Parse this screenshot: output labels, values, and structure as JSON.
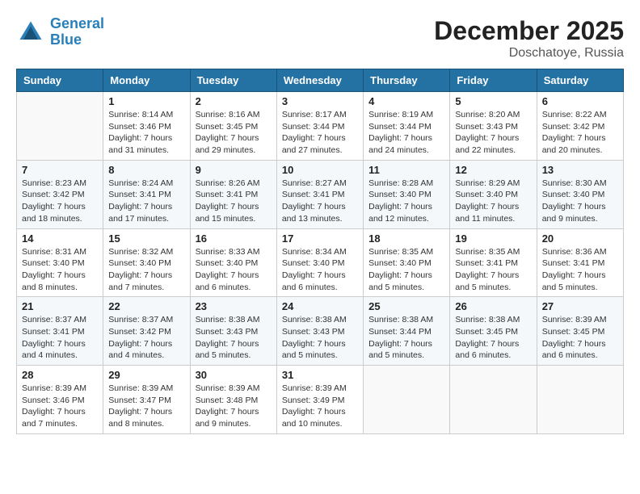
{
  "header": {
    "logo_line1": "General",
    "logo_line2": "Blue",
    "month_title": "December 2025",
    "location": "Doschatoye, Russia"
  },
  "weekdays": [
    "Sunday",
    "Monday",
    "Tuesday",
    "Wednesday",
    "Thursday",
    "Friday",
    "Saturday"
  ],
  "weeks": [
    [
      {
        "day": "",
        "info": ""
      },
      {
        "day": "1",
        "info": "Sunrise: 8:14 AM\nSunset: 3:46 PM\nDaylight: 7 hours\nand 31 minutes."
      },
      {
        "day": "2",
        "info": "Sunrise: 8:16 AM\nSunset: 3:45 PM\nDaylight: 7 hours\nand 29 minutes."
      },
      {
        "day": "3",
        "info": "Sunrise: 8:17 AM\nSunset: 3:44 PM\nDaylight: 7 hours\nand 27 minutes."
      },
      {
        "day": "4",
        "info": "Sunrise: 8:19 AM\nSunset: 3:44 PM\nDaylight: 7 hours\nand 24 minutes."
      },
      {
        "day": "5",
        "info": "Sunrise: 8:20 AM\nSunset: 3:43 PM\nDaylight: 7 hours\nand 22 minutes."
      },
      {
        "day": "6",
        "info": "Sunrise: 8:22 AM\nSunset: 3:42 PM\nDaylight: 7 hours\nand 20 minutes."
      }
    ],
    [
      {
        "day": "7",
        "info": "Sunrise: 8:23 AM\nSunset: 3:42 PM\nDaylight: 7 hours\nand 18 minutes."
      },
      {
        "day": "8",
        "info": "Sunrise: 8:24 AM\nSunset: 3:41 PM\nDaylight: 7 hours\nand 17 minutes."
      },
      {
        "day": "9",
        "info": "Sunrise: 8:26 AM\nSunset: 3:41 PM\nDaylight: 7 hours\nand 15 minutes."
      },
      {
        "day": "10",
        "info": "Sunrise: 8:27 AM\nSunset: 3:41 PM\nDaylight: 7 hours\nand 13 minutes."
      },
      {
        "day": "11",
        "info": "Sunrise: 8:28 AM\nSunset: 3:40 PM\nDaylight: 7 hours\nand 12 minutes."
      },
      {
        "day": "12",
        "info": "Sunrise: 8:29 AM\nSunset: 3:40 PM\nDaylight: 7 hours\nand 11 minutes."
      },
      {
        "day": "13",
        "info": "Sunrise: 8:30 AM\nSunset: 3:40 PM\nDaylight: 7 hours\nand 9 minutes."
      }
    ],
    [
      {
        "day": "14",
        "info": "Sunrise: 8:31 AM\nSunset: 3:40 PM\nDaylight: 7 hours\nand 8 minutes."
      },
      {
        "day": "15",
        "info": "Sunrise: 8:32 AM\nSunset: 3:40 PM\nDaylight: 7 hours\nand 7 minutes."
      },
      {
        "day": "16",
        "info": "Sunrise: 8:33 AM\nSunset: 3:40 PM\nDaylight: 7 hours\nand 6 minutes."
      },
      {
        "day": "17",
        "info": "Sunrise: 8:34 AM\nSunset: 3:40 PM\nDaylight: 7 hours\nand 6 minutes."
      },
      {
        "day": "18",
        "info": "Sunrise: 8:35 AM\nSunset: 3:40 PM\nDaylight: 7 hours\nand 5 minutes."
      },
      {
        "day": "19",
        "info": "Sunrise: 8:35 AM\nSunset: 3:41 PM\nDaylight: 7 hours\nand 5 minutes."
      },
      {
        "day": "20",
        "info": "Sunrise: 8:36 AM\nSunset: 3:41 PM\nDaylight: 7 hours\nand 5 minutes."
      }
    ],
    [
      {
        "day": "21",
        "info": "Sunrise: 8:37 AM\nSunset: 3:41 PM\nDaylight: 7 hours\nand 4 minutes."
      },
      {
        "day": "22",
        "info": "Sunrise: 8:37 AM\nSunset: 3:42 PM\nDaylight: 7 hours\nand 4 minutes."
      },
      {
        "day": "23",
        "info": "Sunrise: 8:38 AM\nSunset: 3:43 PM\nDaylight: 7 hours\nand 5 minutes."
      },
      {
        "day": "24",
        "info": "Sunrise: 8:38 AM\nSunset: 3:43 PM\nDaylight: 7 hours\nand 5 minutes."
      },
      {
        "day": "25",
        "info": "Sunrise: 8:38 AM\nSunset: 3:44 PM\nDaylight: 7 hours\nand 5 minutes."
      },
      {
        "day": "26",
        "info": "Sunrise: 8:38 AM\nSunset: 3:45 PM\nDaylight: 7 hours\nand 6 minutes."
      },
      {
        "day": "27",
        "info": "Sunrise: 8:39 AM\nSunset: 3:45 PM\nDaylight: 7 hours\nand 6 minutes."
      }
    ],
    [
      {
        "day": "28",
        "info": "Sunrise: 8:39 AM\nSunset: 3:46 PM\nDaylight: 7 hours\nand 7 minutes."
      },
      {
        "day": "29",
        "info": "Sunrise: 8:39 AM\nSunset: 3:47 PM\nDaylight: 7 hours\nand 8 minutes."
      },
      {
        "day": "30",
        "info": "Sunrise: 8:39 AM\nSunset: 3:48 PM\nDaylight: 7 hours\nand 9 minutes."
      },
      {
        "day": "31",
        "info": "Sunrise: 8:39 AM\nSunset: 3:49 PM\nDaylight: 7 hours\nand 10 minutes."
      },
      {
        "day": "",
        "info": ""
      },
      {
        "day": "",
        "info": ""
      },
      {
        "day": "",
        "info": ""
      }
    ]
  ]
}
